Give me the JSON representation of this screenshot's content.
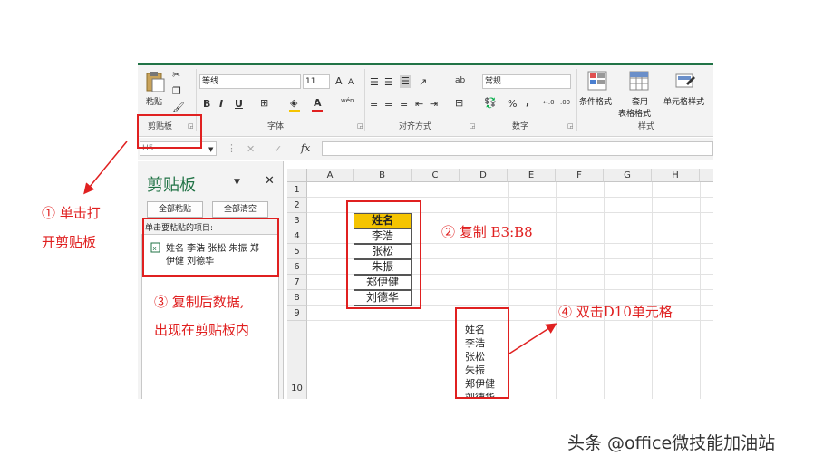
{
  "ribbon": {
    "clipboard": {
      "paste_label": "粘贴",
      "group_label": "剪贴板"
    },
    "font": {
      "name": "等线",
      "size": "11",
      "grow": "A",
      "shrink": "A",
      "bold": "B",
      "italic": "I",
      "underline": "U",
      "font_color_letter": "A",
      "wen": "wén",
      "group_label": "字体"
    },
    "alignment": {
      "wrap": "ab",
      "group_label": "对齐方式"
    },
    "number": {
      "format": "常规",
      "percent": "%",
      "comma": ",",
      "group_label": "数字"
    },
    "styles": {
      "conditional": "条件格式",
      "table_line1": "套用",
      "table_line2": "表格格式",
      "cell_styles": "单元格样式",
      "group_label": "样式"
    }
  },
  "formula_bar": {
    "name_box": "H5",
    "cancel": "✕",
    "enter": "✓",
    "fx": "fx"
  },
  "clipboard_pane": {
    "title": "剪贴板",
    "paste_all": "全部粘贴",
    "clear_all": "全部清空",
    "instruction": "单击要粘贴的项目:",
    "item_line1": "姓名 李浩 张松 朱振 郑",
    "item_line2": "伊健 刘德华"
  },
  "sheet": {
    "columns": [
      "A",
      "B",
      "C",
      "D",
      "E",
      "F",
      "G",
      "H"
    ],
    "rows": [
      "1",
      "2",
      "3",
      "4",
      "5",
      "6",
      "7",
      "8",
      "9",
      "10"
    ],
    "b_header": "姓名",
    "b_names": [
      "李浩",
      "张松",
      "朱振",
      "郑伊健",
      "刘德华"
    ],
    "d10_lines": [
      "姓名",
      "李浩",
      "张松",
      "朱振",
      "郑伊健",
      "刘德华"
    ]
  },
  "annotations": {
    "step1_line1": "① 单击打",
    "step1_line2": "开剪贴板",
    "step2": "② 复制 B3:B8",
    "step3_line1": "③ 复制后数据,",
    "step3_line2": "出现在剪贴板内",
    "step4": "④ 双击D10单元格"
  },
  "watermark": "头条 @office微技能加油站",
  "colors": {
    "header_fill": "#f5c400",
    "annotation_red": "#e02020",
    "excel_green": "#217346"
  }
}
